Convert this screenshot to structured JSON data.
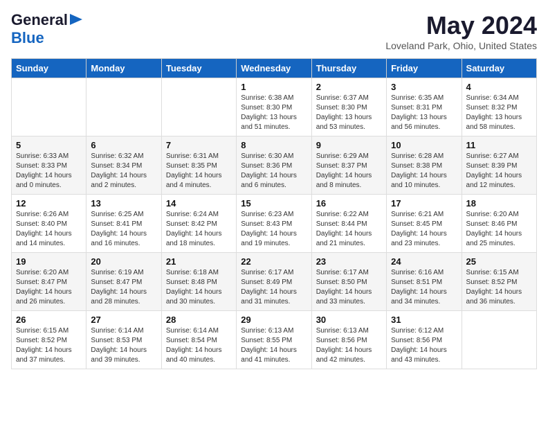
{
  "header": {
    "logo_line1": "General",
    "logo_line2": "Blue",
    "month": "May 2024",
    "location": "Loveland Park, Ohio, United States"
  },
  "days_of_week": [
    "Sunday",
    "Monday",
    "Tuesday",
    "Wednesday",
    "Thursday",
    "Friday",
    "Saturday"
  ],
  "weeks": [
    [
      {
        "day": "",
        "sunrise": "",
        "sunset": "",
        "daylight": ""
      },
      {
        "day": "",
        "sunrise": "",
        "sunset": "",
        "daylight": ""
      },
      {
        "day": "",
        "sunrise": "",
        "sunset": "",
        "daylight": ""
      },
      {
        "day": "1",
        "sunrise": "Sunrise: 6:38 AM",
        "sunset": "Sunset: 8:30 PM",
        "daylight": "Daylight: 13 hours and 51 minutes."
      },
      {
        "day": "2",
        "sunrise": "Sunrise: 6:37 AM",
        "sunset": "Sunset: 8:30 PM",
        "daylight": "Daylight: 13 hours and 53 minutes."
      },
      {
        "day": "3",
        "sunrise": "Sunrise: 6:35 AM",
        "sunset": "Sunset: 8:31 PM",
        "daylight": "Daylight: 13 hours and 56 minutes."
      },
      {
        "day": "4",
        "sunrise": "Sunrise: 6:34 AM",
        "sunset": "Sunset: 8:32 PM",
        "daylight": "Daylight: 13 hours and 58 minutes."
      }
    ],
    [
      {
        "day": "5",
        "sunrise": "Sunrise: 6:33 AM",
        "sunset": "Sunset: 8:33 PM",
        "daylight": "Daylight: 14 hours and 0 minutes."
      },
      {
        "day": "6",
        "sunrise": "Sunrise: 6:32 AM",
        "sunset": "Sunset: 8:34 PM",
        "daylight": "Daylight: 14 hours and 2 minutes."
      },
      {
        "day": "7",
        "sunrise": "Sunrise: 6:31 AM",
        "sunset": "Sunset: 8:35 PM",
        "daylight": "Daylight: 14 hours and 4 minutes."
      },
      {
        "day": "8",
        "sunrise": "Sunrise: 6:30 AM",
        "sunset": "Sunset: 8:36 PM",
        "daylight": "Daylight: 14 hours and 6 minutes."
      },
      {
        "day": "9",
        "sunrise": "Sunrise: 6:29 AM",
        "sunset": "Sunset: 8:37 PM",
        "daylight": "Daylight: 14 hours and 8 minutes."
      },
      {
        "day": "10",
        "sunrise": "Sunrise: 6:28 AM",
        "sunset": "Sunset: 8:38 PM",
        "daylight": "Daylight: 14 hours and 10 minutes."
      },
      {
        "day": "11",
        "sunrise": "Sunrise: 6:27 AM",
        "sunset": "Sunset: 8:39 PM",
        "daylight": "Daylight: 14 hours and 12 minutes."
      }
    ],
    [
      {
        "day": "12",
        "sunrise": "Sunrise: 6:26 AM",
        "sunset": "Sunset: 8:40 PM",
        "daylight": "Daylight: 14 hours and 14 minutes."
      },
      {
        "day": "13",
        "sunrise": "Sunrise: 6:25 AM",
        "sunset": "Sunset: 8:41 PM",
        "daylight": "Daylight: 14 hours and 16 minutes."
      },
      {
        "day": "14",
        "sunrise": "Sunrise: 6:24 AM",
        "sunset": "Sunset: 8:42 PM",
        "daylight": "Daylight: 14 hours and 18 minutes."
      },
      {
        "day": "15",
        "sunrise": "Sunrise: 6:23 AM",
        "sunset": "Sunset: 8:43 PM",
        "daylight": "Daylight: 14 hours and 19 minutes."
      },
      {
        "day": "16",
        "sunrise": "Sunrise: 6:22 AM",
        "sunset": "Sunset: 8:44 PM",
        "daylight": "Daylight: 14 hours and 21 minutes."
      },
      {
        "day": "17",
        "sunrise": "Sunrise: 6:21 AM",
        "sunset": "Sunset: 8:45 PM",
        "daylight": "Daylight: 14 hours and 23 minutes."
      },
      {
        "day": "18",
        "sunrise": "Sunrise: 6:20 AM",
        "sunset": "Sunset: 8:46 PM",
        "daylight": "Daylight: 14 hours and 25 minutes."
      }
    ],
    [
      {
        "day": "19",
        "sunrise": "Sunrise: 6:20 AM",
        "sunset": "Sunset: 8:47 PM",
        "daylight": "Daylight: 14 hours and 26 minutes."
      },
      {
        "day": "20",
        "sunrise": "Sunrise: 6:19 AM",
        "sunset": "Sunset: 8:47 PM",
        "daylight": "Daylight: 14 hours and 28 minutes."
      },
      {
        "day": "21",
        "sunrise": "Sunrise: 6:18 AM",
        "sunset": "Sunset: 8:48 PM",
        "daylight": "Daylight: 14 hours and 30 minutes."
      },
      {
        "day": "22",
        "sunrise": "Sunrise: 6:17 AM",
        "sunset": "Sunset: 8:49 PM",
        "daylight": "Daylight: 14 hours and 31 minutes."
      },
      {
        "day": "23",
        "sunrise": "Sunrise: 6:17 AM",
        "sunset": "Sunset: 8:50 PM",
        "daylight": "Daylight: 14 hours and 33 minutes."
      },
      {
        "day": "24",
        "sunrise": "Sunrise: 6:16 AM",
        "sunset": "Sunset: 8:51 PM",
        "daylight": "Daylight: 14 hours and 34 minutes."
      },
      {
        "day": "25",
        "sunrise": "Sunrise: 6:15 AM",
        "sunset": "Sunset: 8:52 PM",
        "daylight": "Daylight: 14 hours and 36 minutes."
      }
    ],
    [
      {
        "day": "26",
        "sunrise": "Sunrise: 6:15 AM",
        "sunset": "Sunset: 8:52 PM",
        "daylight": "Daylight: 14 hours and 37 minutes."
      },
      {
        "day": "27",
        "sunrise": "Sunrise: 6:14 AM",
        "sunset": "Sunset: 8:53 PM",
        "daylight": "Daylight: 14 hours and 39 minutes."
      },
      {
        "day": "28",
        "sunrise": "Sunrise: 6:14 AM",
        "sunset": "Sunset: 8:54 PM",
        "daylight": "Daylight: 14 hours and 40 minutes."
      },
      {
        "day": "29",
        "sunrise": "Sunrise: 6:13 AM",
        "sunset": "Sunset: 8:55 PM",
        "daylight": "Daylight: 14 hours and 41 minutes."
      },
      {
        "day": "30",
        "sunrise": "Sunrise: 6:13 AM",
        "sunset": "Sunset: 8:56 PM",
        "daylight": "Daylight: 14 hours and 42 minutes."
      },
      {
        "day": "31",
        "sunrise": "Sunrise: 6:12 AM",
        "sunset": "Sunset: 8:56 PM",
        "daylight": "Daylight: 14 hours and 43 minutes."
      },
      {
        "day": "",
        "sunrise": "",
        "sunset": "",
        "daylight": ""
      }
    ]
  ]
}
